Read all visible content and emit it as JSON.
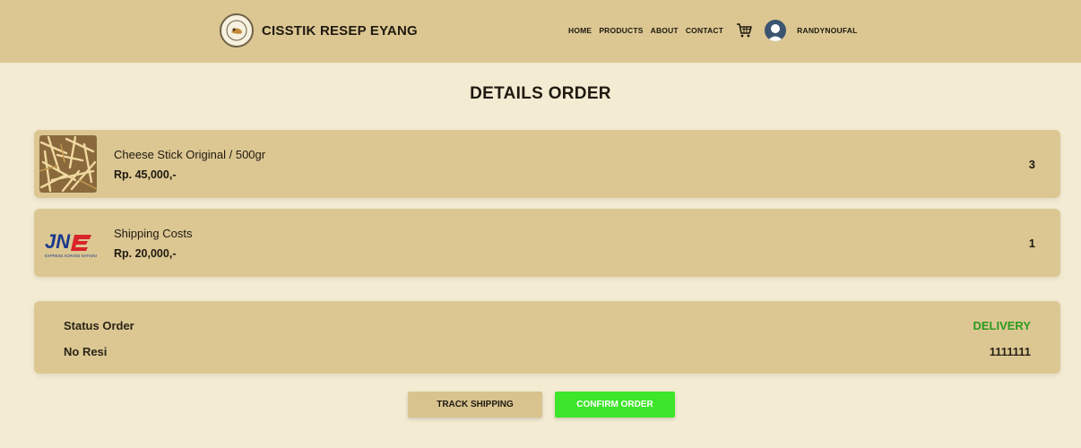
{
  "navbar": {
    "brand": "CISSTIK RESEP EYANG",
    "links": [
      "HOME",
      "PRODUCTS",
      "ABOUT",
      "CONTACT"
    ],
    "cart_icon": "cart-icon",
    "user": "RANDYNOUFAL"
  },
  "page": {
    "title": "DETAILS ORDER"
  },
  "items": [
    {
      "name": "Cheese Stick Original / 500gr",
      "price": "Rp. 45,000,-",
      "qty": "3",
      "thumb": "cheese-stick-photo"
    },
    {
      "name": "Shipping Costs",
      "price": "Rp. 20,000,-",
      "qty": "1",
      "thumb": "jne-logo"
    }
  ],
  "order": {
    "status_label": "Status Order",
    "status_value": "DELIVERY",
    "resi_label": "No Resi",
    "resi_value": "1111111"
  },
  "buttons": {
    "track": "TRACK SHIPPING",
    "confirm": "CONFIRM ORDER"
  },
  "colors": {
    "navbar": "#dcc793",
    "background": "#f3ebd2",
    "status": "#2b9a1f",
    "confirm": "#3de62a"
  }
}
